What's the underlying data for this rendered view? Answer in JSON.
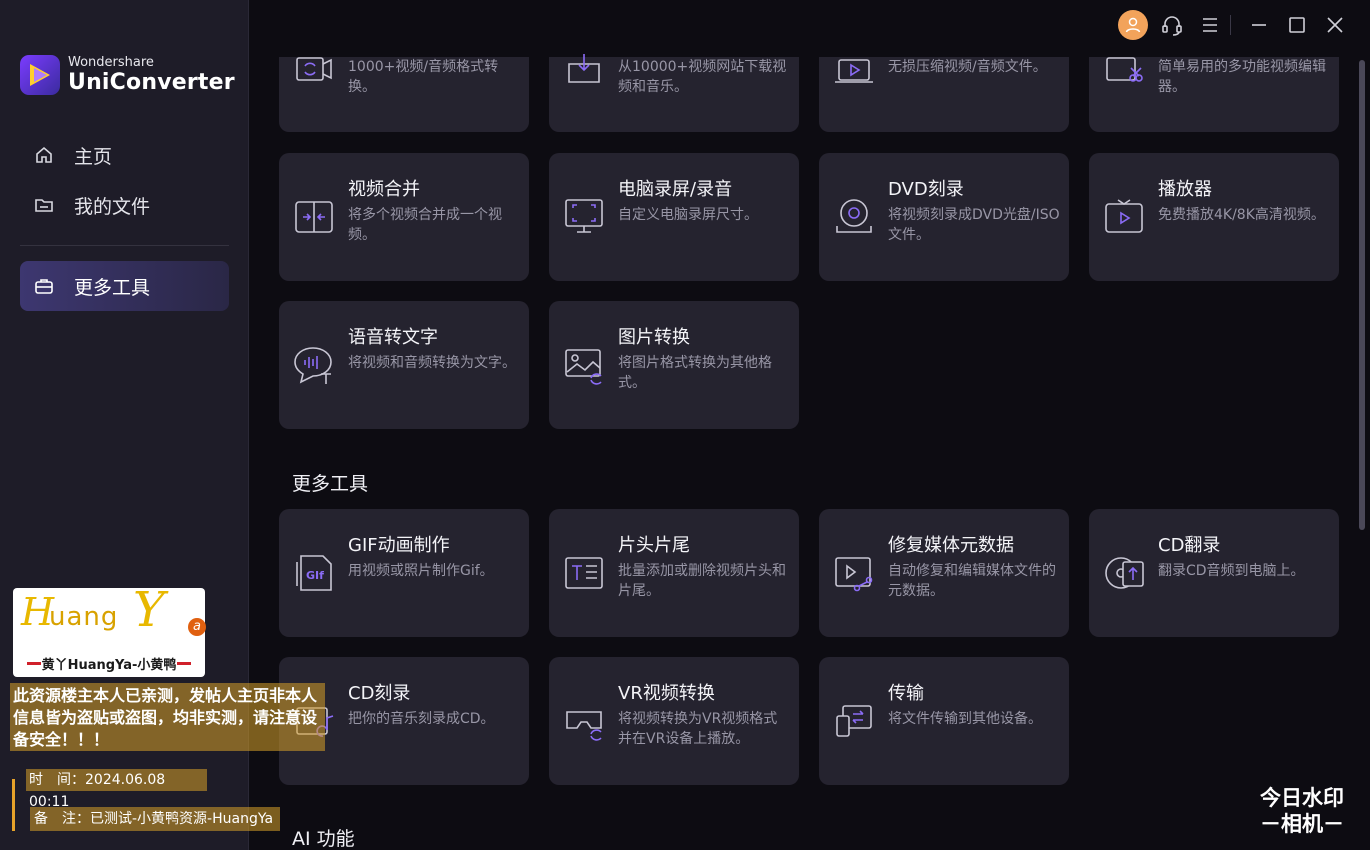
{
  "app": {
    "brand_small": "Wondershare",
    "brand_big": "UniConverter"
  },
  "sidebar": {
    "items": [
      {
        "label": "主页",
        "icon": "home-icon"
      },
      {
        "label": "我的文件",
        "icon": "folder-icon"
      },
      {
        "label": "更多工具",
        "icon": "toolbox-icon",
        "active": true
      }
    ]
  },
  "titlebar": {
    "icons": [
      "avatar-icon",
      "headset-icon",
      "menu-icon",
      "minimize-icon",
      "maximize-icon",
      "close-icon"
    ]
  },
  "top_tools": [
    {
      "title": "",
      "desc": "1000+视频/音频格式转换。",
      "icon": "convert-icon"
    },
    {
      "title": "",
      "desc": "从10000+视频网站下载视频和音乐。",
      "icon": "download-icon"
    },
    {
      "title": "",
      "desc": "无损压缩视频/音频文件。",
      "icon": "compress-icon"
    },
    {
      "title": "",
      "desc": "简单易用的多功能视频编辑器。",
      "icon": "editor-icon"
    },
    {
      "title": "视频合并",
      "desc": "将多个视频合并成一个视频。",
      "icon": "merge-icon"
    },
    {
      "title": "电脑录屏/录音",
      "desc": "自定义电脑录屏尺寸。",
      "icon": "screen-record-icon"
    },
    {
      "title": "DVD刻录",
      "desc": "将视频刻录成DVD光盘/ISO文件。",
      "icon": "dvd-burn-icon"
    },
    {
      "title": "播放器",
      "desc": "免费播放4K/8K高清视频。",
      "icon": "player-icon"
    },
    {
      "title": "语音转文字",
      "desc": "将视频和音频转换为文字。",
      "icon": "speech-to-text-icon"
    },
    {
      "title": "图片转换",
      "desc": "将图片格式转换为其他格式。",
      "icon": "image-convert-icon"
    }
  ],
  "more_tools": {
    "heading": "更多工具",
    "items": [
      {
        "title": "GIF动画制作",
        "desc": "用视频或照片制作Gif。",
        "icon": "gif-icon"
      },
      {
        "title": "片头片尾",
        "desc": "批量添加或删除视频片头和片尾。",
        "icon": "intro-outro-icon"
      },
      {
        "title": "修复媒体元数据",
        "desc": "自动修复和编辑媒体文件的元数据。",
        "icon": "metadata-icon"
      },
      {
        "title": "CD翻录",
        "desc": "翻录CD音频到电脑上。",
        "icon": "cd-rip-icon"
      },
      {
        "title": "CD刻录",
        "desc": "把你的音乐刻录成CD。",
        "icon": "cd-burn-icon"
      },
      {
        "title": "VR视频转换",
        "desc": "将视频转换为VR视频格式并在VR设备上播放。",
        "icon": "vr-icon"
      },
      {
        "title": "传输",
        "desc": "将文件传输到其他设备。",
        "icon": "transfer-icon"
      }
    ]
  },
  "ai_section": {
    "heading": "AI 功能"
  },
  "watermark": {
    "logo_h": "H",
    "logo_uang": "uang",
    "logo_y": "Y",
    "logo_a": "a",
    "logo_sub": "黄丫HuangYa-小黄鸭",
    "warning": "此资源楼主本人已亲测，发帖人主页非本人信息皆为盗贴或盗图，均非实测，请注意设备安全！！！",
    "time_label": "时　间：",
    "time_value": "2024.06.08 00:11",
    "note_label": "备　注：",
    "note_value": "已测试-小黄鸭资源-HuangYa",
    "brand_line1": "今日水印",
    "brand_line2": "－相机－"
  },
  "colors": {
    "accent": "#8b6cf6",
    "card_bg": "#25232f",
    "sidebar_bg": "#1e1c28",
    "main_bg": "#0d0c12",
    "avatar": "#f2a35b"
  }
}
